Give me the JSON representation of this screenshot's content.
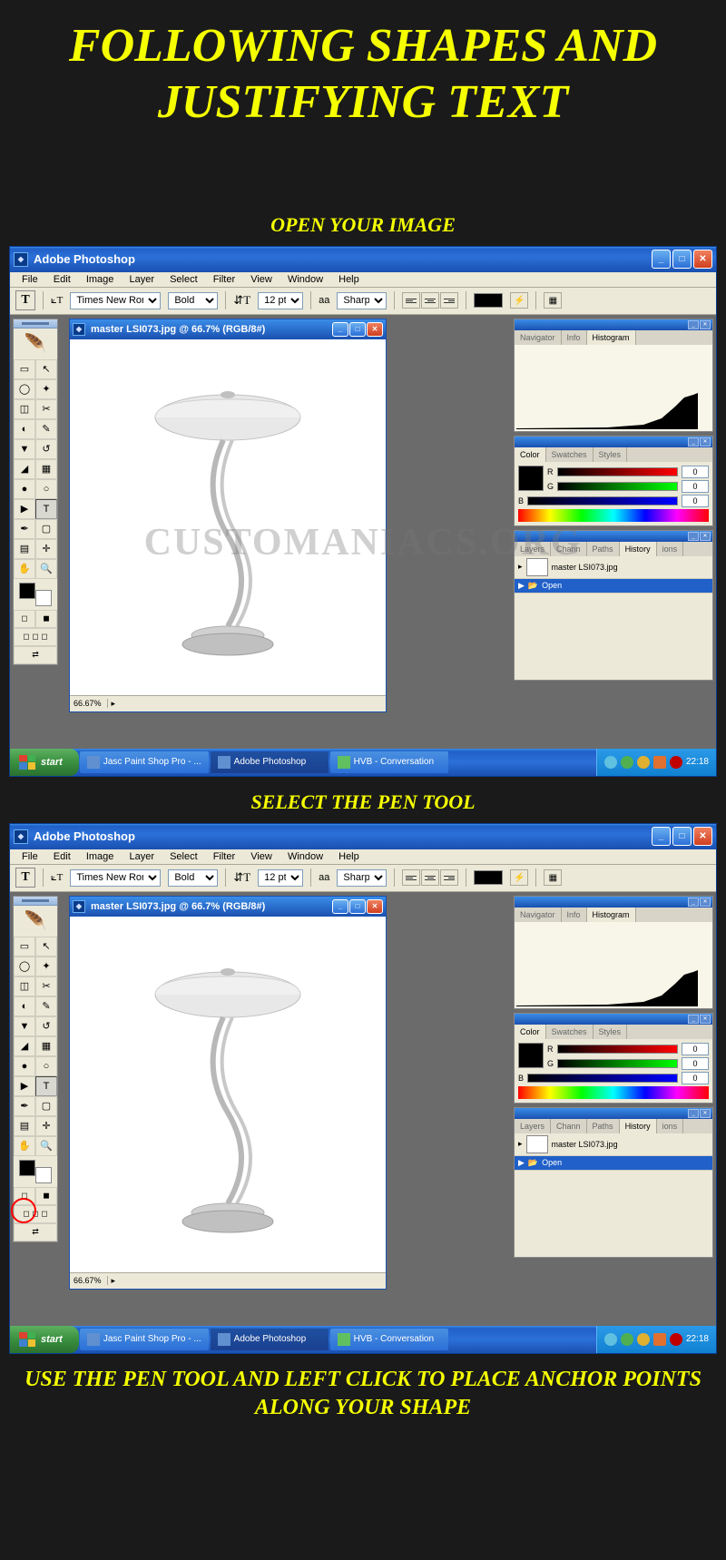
{
  "tutorial": {
    "title": "FOLLOWING SHAPES AND JUSTIFYING TEXT",
    "step1": "OPEN YOUR IMAGE",
    "step2": "SELECT THE PEN TOOL",
    "step3": "USE THE PEN TOOL AND LEFT CLICK TO PLACE ANCHOR POINTS ALONG YOUR SHAPE"
  },
  "app_title": "Adobe Photoshop",
  "menubar": [
    "File",
    "Edit",
    "Image",
    "Layer",
    "Select",
    "Filter",
    "View",
    "Window",
    "Help"
  ],
  "optionsbar": {
    "font_family": "Times New Roman",
    "font_weight": "Bold",
    "font_size": "12 pt",
    "aa_label": "aa",
    "antialiasing": "Sharp"
  },
  "document": {
    "title": "master LSI073.jpg @ 66.7% (RGB/8#)",
    "zoom": "66.67%"
  },
  "panels": {
    "navigator": {
      "tabs": [
        "Navigator",
        "Info",
        "Histogram"
      ],
      "active": 2
    },
    "color": {
      "tabs": [
        "Color",
        "Swatches",
        "Styles"
      ],
      "active": 0,
      "r_label": "R",
      "r_val": "0",
      "g_label": "G",
      "g_val": "0",
      "b_label": "B",
      "b_val": "0"
    },
    "history": {
      "tabs": [
        "Layers",
        "Chann",
        "Paths",
        "History",
        "ions"
      ],
      "active": 3,
      "snapshot": "master LSI073.jpg",
      "item": "Open"
    }
  },
  "taskbar": {
    "start": "start",
    "items": [
      "Jasc Paint Shop Pro - ...",
      "Adobe Photoshop",
      "HVB - Conversation"
    ],
    "time": "22:18"
  },
  "watermark": "CUSTOMANIACS.ORG"
}
